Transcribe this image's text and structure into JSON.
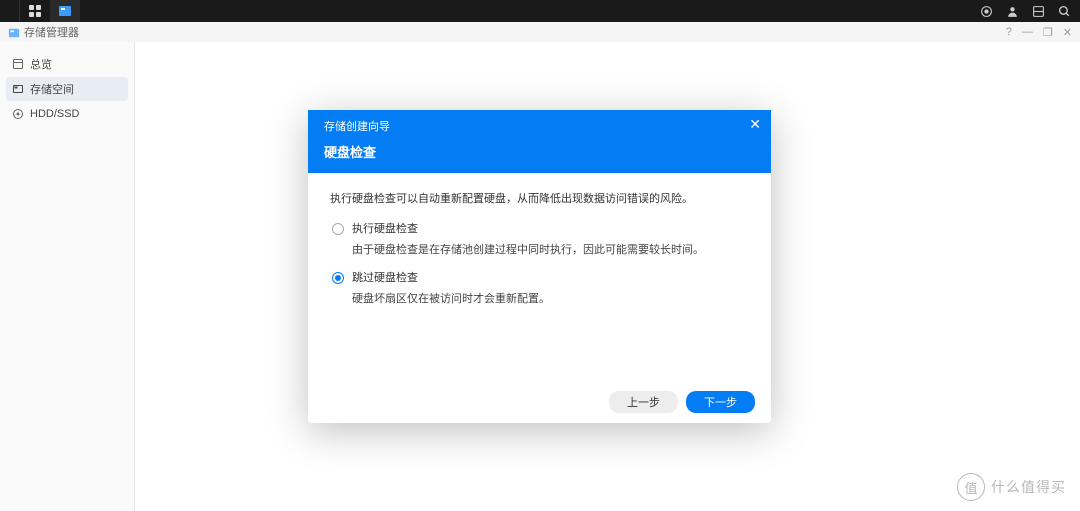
{
  "window": {
    "title": "存储管理器"
  },
  "sidebar": {
    "items": [
      {
        "label": "总览",
        "icon": "overview"
      },
      {
        "label": "存储空间",
        "icon": "storage",
        "active": true
      },
      {
        "label": "HDD/SSD",
        "icon": "disk"
      }
    ]
  },
  "modal": {
    "breadcrumb": "存储创建向导",
    "title": "硬盘检查",
    "description": "执行硬盘检查可以自动重新配置硬盘，从而降低出现数据访问错误的风险。",
    "options": [
      {
        "label": "执行硬盘检查",
        "hint": "由于硬盘检查是在存储池创建过程中同时执行，因此可能需要较长时间。",
        "selected": false
      },
      {
        "label": "跳过硬盘检查",
        "hint": "硬盘坏扇区仅在被访问时才会重新配置。",
        "selected": true
      }
    ],
    "buttons": {
      "back": "上一步",
      "next": "下一步"
    }
  },
  "watermark": {
    "icon": "值",
    "text": "什么值得买"
  }
}
